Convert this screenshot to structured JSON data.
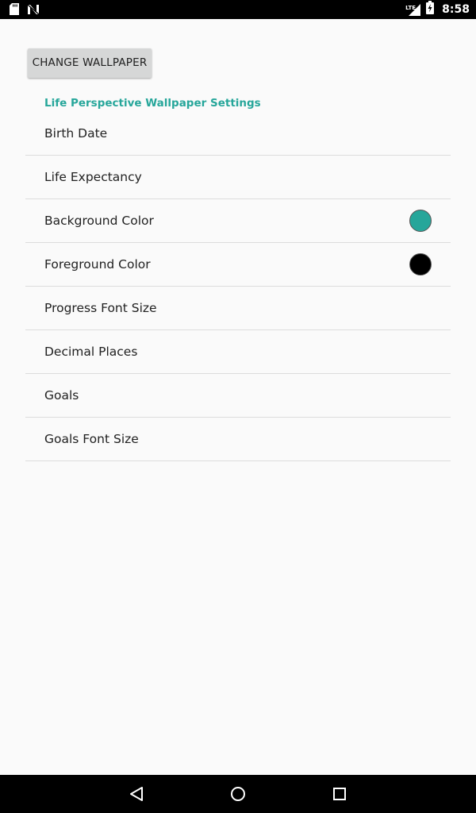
{
  "status_bar": {
    "time": "8:58",
    "network": "LTE",
    "icons": [
      "sd-card-icon",
      "n-notification-icon",
      "signal-icon",
      "battery-icon"
    ]
  },
  "toolbar": {
    "change_wallpaper_label": "CHANGE WALLPAPER"
  },
  "settings": {
    "category_title": "Life Perspective Wallpaper Settings",
    "items": [
      {
        "label": "Birth Date"
      },
      {
        "label": "Life Expectancy"
      },
      {
        "label": "Background Color",
        "color": "#26a69a"
      },
      {
        "label": "Foreground Color",
        "color": "#000000"
      },
      {
        "label": "Progress Font Size"
      },
      {
        "label": "Decimal Places"
      },
      {
        "label": "Goals"
      },
      {
        "label": "Goals Font Size"
      }
    ]
  },
  "nav_bar": {
    "buttons": [
      "back-icon",
      "home-icon",
      "recents-icon"
    ]
  },
  "colors": {
    "accent": "#26a69a",
    "background": "#fafafa",
    "divider": "#dcdcdc",
    "button_bg": "#d6d7d7"
  }
}
